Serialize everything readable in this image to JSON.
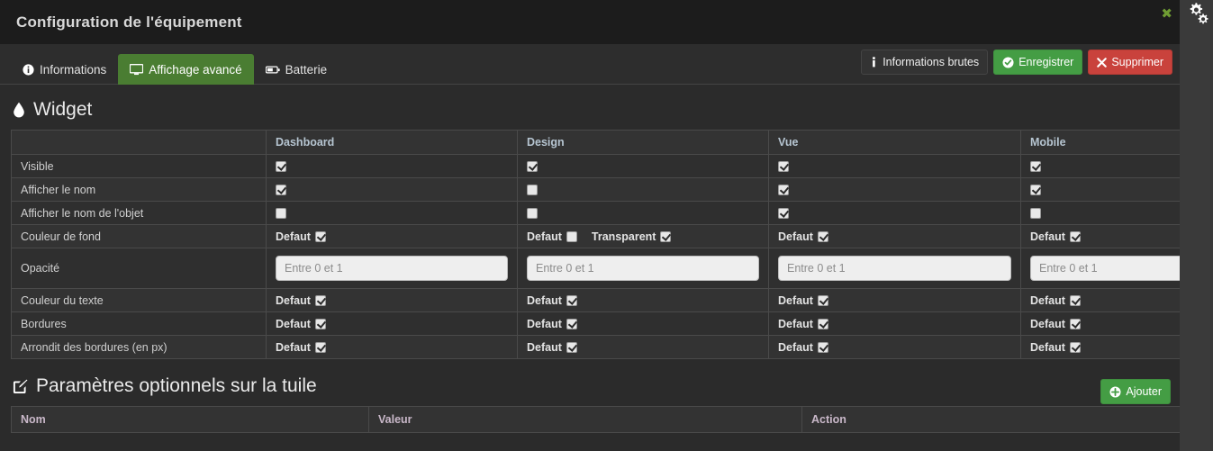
{
  "window": {
    "title": "Configuration de l'équipement",
    "close_label": "✖",
    "gear_icon": "gears-icon"
  },
  "tabs": [
    {
      "label": "Informations",
      "icon": "info-circle-icon",
      "active": false
    },
    {
      "label": "Affichage avancé",
      "icon": "desktop-icon",
      "active": true
    },
    {
      "label": "Batterie",
      "icon": "battery-icon",
      "active": false
    }
  ],
  "header_buttons": [
    {
      "label": "Informations brutes",
      "icon": "info-icon",
      "style": "dark"
    },
    {
      "label": "Enregistrer",
      "icon": "check-circle-icon",
      "style": "green"
    },
    {
      "label": "Supprimer",
      "icon": "times-icon",
      "style": "red"
    }
  ],
  "widget": {
    "section_title": "Widget",
    "section_icon": "tint-icon",
    "columns": [
      "",
      "Dashboard",
      "Design",
      "Vue",
      "Mobile"
    ],
    "rows": [
      {
        "label": "Visible",
        "type": "checkbox",
        "cells": [
          {
            "checked": true
          },
          {
            "checked": true
          },
          {
            "checked": true
          },
          {
            "checked": true
          }
        ]
      },
      {
        "label": "Afficher le nom",
        "type": "checkbox",
        "cells": [
          {
            "checked": true
          },
          {
            "checked": false
          },
          {
            "checked": true
          },
          {
            "checked": true
          }
        ]
      },
      {
        "label": "Afficher le nom de l'objet",
        "type": "checkbox",
        "cells": [
          {
            "checked": false
          },
          {
            "checked": false
          },
          {
            "checked": true
          },
          {
            "checked": false
          }
        ]
      },
      {
        "label": "Couleur de fond",
        "type": "options",
        "cells": [
          {
            "options": [
              {
                "label": "Defaut",
                "checked": true
              }
            ]
          },
          {
            "options": [
              {
                "label": "Defaut",
                "checked": false
              },
              {
                "label": "Transparent",
                "checked": true
              }
            ]
          },
          {
            "options": [
              {
                "label": "Defaut",
                "checked": true
              }
            ]
          },
          {
            "options": [
              {
                "label": "Defaut",
                "checked": true
              }
            ]
          }
        ]
      },
      {
        "label": "Opacité",
        "type": "input",
        "cells": [
          {
            "value": "",
            "placeholder": "Entre 0 et 1"
          },
          {
            "value": "",
            "placeholder": "Entre 0 et 1"
          },
          {
            "value": "",
            "placeholder": "Entre 0 et 1"
          },
          {
            "value": "",
            "placeholder": "Entre 0 et 1"
          }
        ]
      },
      {
        "label": "Couleur du texte",
        "type": "options",
        "cells": [
          {
            "options": [
              {
                "label": "Defaut",
                "checked": true
              }
            ]
          },
          {
            "options": [
              {
                "label": "Defaut",
                "checked": true
              }
            ]
          },
          {
            "options": [
              {
                "label": "Defaut",
                "checked": true
              }
            ]
          },
          {
            "options": [
              {
                "label": "Defaut",
                "checked": true
              }
            ]
          }
        ]
      },
      {
        "label": "Bordures",
        "type": "options",
        "cells": [
          {
            "options": [
              {
                "label": "Defaut",
                "checked": true
              }
            ]
          },
          {
            "options": [
              {
                "label": "Defaut",
                "checked": true
              }
            ]
          },
          {
            "options": [
              {
                "label": "Defaut",
                "checked": true
              }
            ]
          },
          {
            "options": [
              {
                "label": "Defaut",
                "checked": true
              }
            ]
          }
        ]
      },
      {
        "label": "Arrondit des bordures (en px)",
        "type": "options",
        "cells": [
          {
            "options": [
              {
                "label": "Defaut",
                "checked": true
              }
            ]
          },
          {
            "options": [
              {
                "label": "Defaut",
                "checked": true
              }
            ]
          },
          {
            "options": [
              {
                "label": "Defaut",
                "checked": true
              }
            ]
          },
          {
            "options": [
              {
                "label": "Defaut",
                "checked": true
              }
            ]
          }
        ]
      }
    ]
  },
  "params": {
    "section_title": "Paramètres optionnels sur la tuile",
    "section_icon": "edit-icon",
    "add_button": {
      "label": "Ajouter",
      "icon": "plus-circle-icon"
    },
    "columns": [
      "Nom",
      "Valeur",
      "Action"
    ],
    "rows": []
  },
  "colors": {
    "accent_green": "#449d44",
    "tab_active": "#4a7d32",
    "danger_red": "#c9423c",
    "panel_bg": "#2b2b2b",
    "titlebar_bg": "#1c1c1c",
    "page_bg": "#3a3a3a"
  }
}
